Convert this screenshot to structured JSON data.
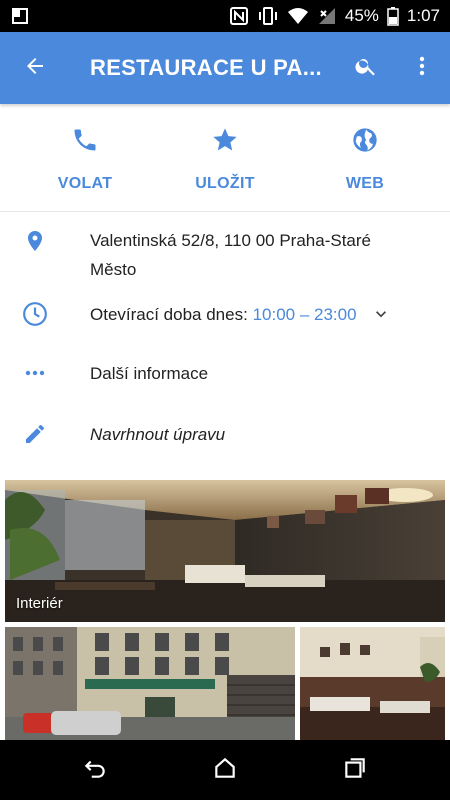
{
  "status_bar": {
    "battery": "45%",
    "time": "1:07",
    "icons": [
      "sim-icon",
      "nfc-icon",
      "vibrate-icon",
      "wifi-icon",
      "signal-icon",
      "battery-icon"
    ]
  },
  "app_bar": {
    "title": "RESTAURACE U PA...",
    "icons": [
      "back-arrow-icon",
      "search-icon",
      "more-vert-icon"
    ]
  },
  "actions": [
    {
      "label": "VOLAT",
      "icon": "phone-icon"
    },
    {
      "label": "ULOŽIT",
      "icon": "star-icon"
    },
    {
      "label": "WEB",
      "icon": "globe-icon"
    }
  ],
  "info": {
    "address_line1": "Valentinská 52/8, 110 00 Praha-Staré",
    "address_line2": "Město",
    "hours_label": "Otevírací doba dnes:",
    "hours_value": "10:00 – 23:00",
    "more_info": "Další informace",
    "suggest_edit": "Navrhnout úpravu"
  },
  "photos": {
    "main_label": "Interiér"
  },
  "colors": {
    "accent": "#4a89dc",
    "text": "#222222"
  },
  "nav_bar": {
    "icons": [
      "back-nav-icon",
      "home-nav-icon",
      "recents-nav-icon"
    ]
  }
}
